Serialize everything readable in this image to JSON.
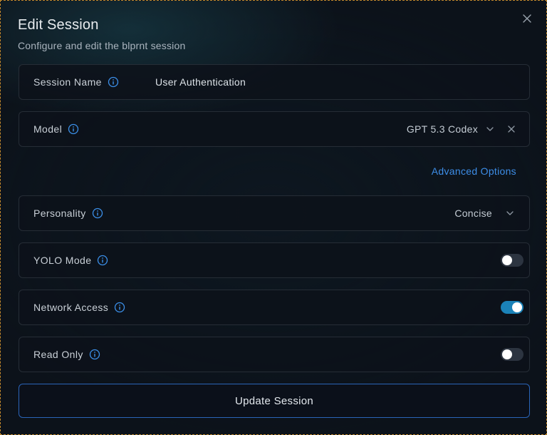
{
  "dialog": {
    "title": "Edit Session",
    "subtitle": "Configure and edit the blprnt session",
    "close_icon": "close-icon"
  },
  "fields": {
    "session_name": {
      "label": "Session Name",
      "value": "User Authentication"
    },
    "model": {
      "label": "Model",
      "value": "GPT 5.3 Codex"
    },
    "advanced_options": "Advanced Options",
    "personality": {
      "label": "Personality",
      "value": "Concise"
    },
    "yolo_mode": {
      "label": "YOLO Mode",
      "enabled": false
    },
    "network_access": {
      "label": "Network Access",
      "enabled": true
    },
    "read_only": {
      "label": "Read Only",
      "enabled": false
    }
  },
  "actions": {
    "submit_label": "Update Session"
  },
  "colors": {
    "accent": "#3d8ee8",
    "toggle_on": "#1b82b8",
    "toggle_off": "#2c3440",
    "background": "#0c121a"
  }
}
